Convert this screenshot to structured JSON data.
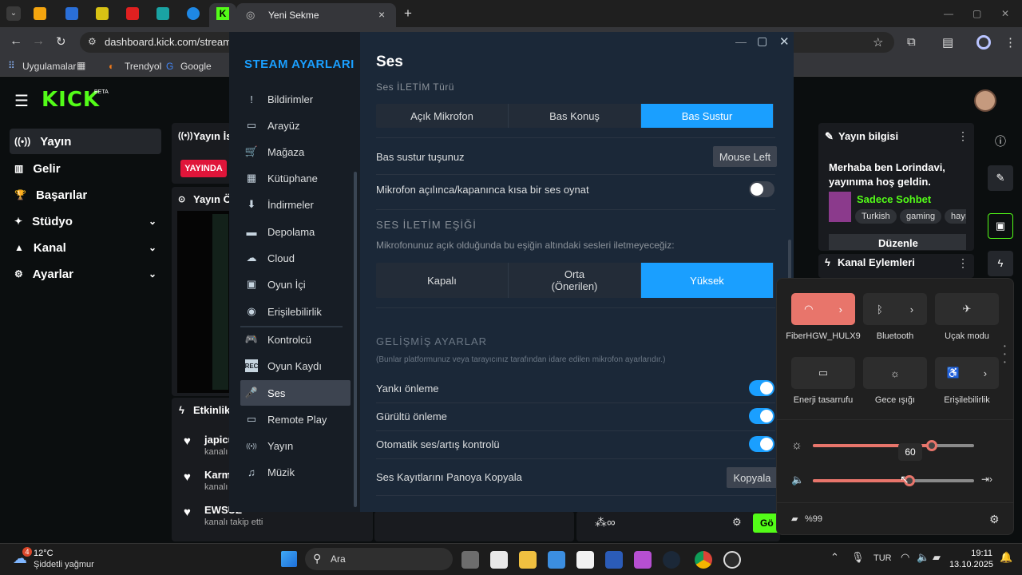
{
  "browser": {
    "tab_title": "Yeni Sekme",
    "url": "dashboard.kick.com/stream",
    "bookmarks": [
      "Uygulamalar",
      "Trendyol",
      "Google"
    ]
  },
  "kick": {
    "logo": "KICK",
    "logo_badge": "BETA",
    "nav": [
      {
        "label": "Yayın"
      },
      {
        "label": "Gelir"
      },
      {
        "label": "Başarılar"
      },
      {
        "label": "Stüdyo"
      },
      {
        "label": "Kanal"
      },
      {
        "label": "Ayarlar"
      }
    ],
    "stream_panel_title": "Yayın İst",
    "live_badge": "YAYINDA",
    "preview_panel_title": "Yayın Ön",
    "activity_panel_title": "Etkinlik",
    "activity": [
      {
        "name": "japicu",
        "sub": "kanalı"
      },
      {
        "name": "Karm",
        "sub": "kanalı"
      },
      {
        "name": "EWSUZ",
        "sub": "kanalı takip etti"
      }
    ],
    "stream_info_title": "Yayın bilgisi",
    "stream_info_text": "Merhaba ben Lorindavi, yayınıma hoş geldin.",
    "category": "Sadece Sohbet",
    "tags": [
      "Turkish",
      "gaming",
      "hayı"
    ],
    "edit_button": "Düzenle",
    "channel_actions_title": "Kanal Eylemleri",
    "go_button": "Gö"
  },
  "steam": {
    "title": "STEAM AYARLARI",
    "sidebar": [
      {
        "label": "Bildirimler",
        "icon": "!"
      },
      {
        "label": "Arayüz",
        "icon": "▭"
      },
      {
        "label": "Mağaza",
        "icon": "🛒"
      },
      {
        "label": "Kütüphane",
        "icon": "▦"
      },
      {
        "label": "İndirmeler",
        "icon": "⬇"
      },
      {
        "label": "Depolama",
        "icon": "▬"
      },
      {
        "label": "Cloud",
        "icon": "☁"
      },
      {
        "label": "Oyun İçi",
        "icon": "▣"
      },
      {
        "label": "Erişilebilirlik",
        "icon": "◉"
      },
      {
        "label": "Kontrolcü",
        "icon": "🎮"
      },
      {
        "label": "Oyun Kaydı",
        "icon": "REC"
      },
      {
        "label": "Ses",
        "icon": "🎤"
      },
      {
        "label": "Remote Play",
        "icon": "▭"
      },
      {
        "label": "Yayın",
        "icon": "((•))"
      },
      {
        "label": "Müzik",
        "icon": "♫"
      }
    ],
    "page_title": "Ses",
    "transmit_type_header": "Ses İLETİM Türü",
    "transmit_options": [
      "Açık Mikrofon",
      "Bas Konuş",
      "Bas Sustur"
    ],
    "ptm_key_label": "Bas sustur tuşunuz",
    "ptm_key_value": "Mouse Left",
    "play_sound_label": "Mikrofon açılınca/kapanınca kısa bir ses oynat",
    "threshold_header": "SES İLETİM EŞİĞİ",
    "threshold_desc": "Mikrofonunuz açık olduğunda bu eşiğin altındaki sesleri iletmeyeceğiz:",
    "threshold_options": [
      "Kapalı",
      "Orta",
      "(Önerilen)",
      "Yüksek"
    ],
    "advanced_header": "GELİŞMİŞ AYARLAR",
    "advanced_desc": "(Bunlar platformunuz veya tarayıcınız tarafından idare edilen mikrofon ayarlarıdır.)",
    "echo_label": "Yankı önleme",
    "noise_label": "Gürültü önleme",
    "agc_label": "Otomatik ses/artış kontrolü",
    "copy_label": "Ses Kayıtlarını Panoya Kopyala",
    "copy_button": "Kopyala"
  },
  "quick_settings": {
    "wifi_label": "FiberHGW_HULX9",
    "bluetooth_label": "Bluetooth",
    "airplane_label": "Uçak modu",
    "energy_label": "Enerji tasarrufu",
    "night_label": "Gece ışığı",
    "access_label": "Erişilebilirlik",
    "brightness": 60,
    "brightness_tooltip": "60",
    "volume": 60,
    "battery": "%99"
  },
  "taskbar": {
    "weather_temp": "12°C",
    "weather_desc": "Şiddetli yağmur",
    "weather_badge": "4",
    "search_label": "Ara",
    "lang": "TUR",
    "time": "19:11",
    "date": "13.10.2025"
  },
  "colors": {
    "kick_green": "#53fc18",
    "steam_blue": "#1a9fff",
    "wifi_tile": "#e8756b"
  }
}
